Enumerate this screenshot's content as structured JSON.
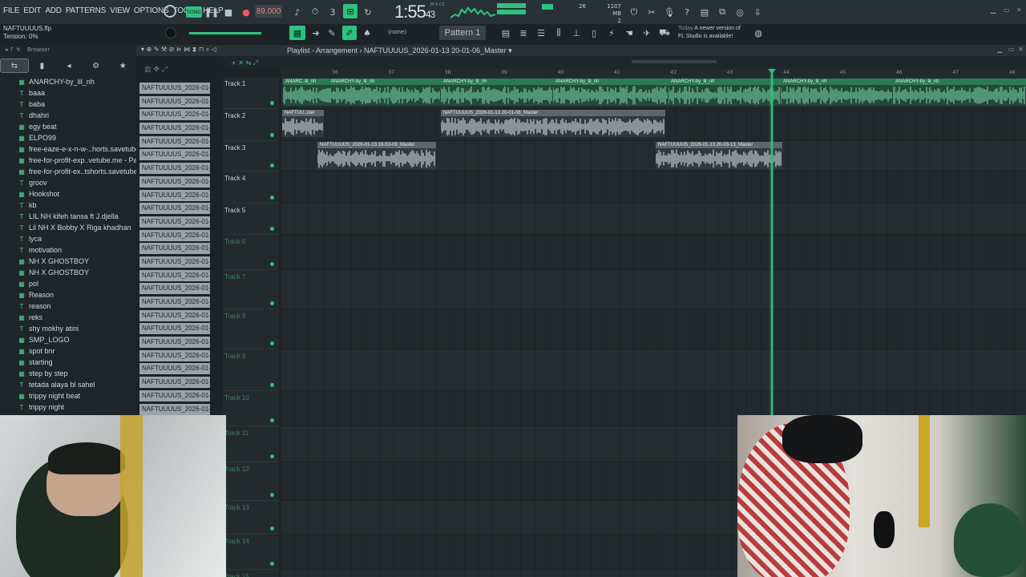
{
  "menu": [
    "FILE",
    "EDIT",
    "ADD",
    "PATTERNS",
    "VIEW",
    "OPTIONS",
    "TOOLS",
    "HELP"
  ],
  "song": {
    "file": "NAFTUUUUS.flp",
    "tension_label": "Tension:",
    "tension_value": "0%"
  },
  "transport": {
    "song_label": "SONG",
    "tempo": "89.000",
    "time_main": "1:55",
    "time_small": "43",
    "time_unit": "M:S:CS",
    "cpu": "26",
    "memory": "1107 MB",
    "polyphony": "2"
  },
  "toolbar": {
    "none_label": "(none)",
    "pattern": "Pattern 1"
  },
  "news": {
    "when": "Today",
    "line1": "A newer version of",
    "line2": "FL Studio is available!"
  },
  "browser": {
    "title": "Browser",
    "items": [
      {
        "name": "ANARCHY-by_lil_nh",
        "icon": "audio-file-icon"
      },
      {
        "name": "baaa",
        "icon": "sample-icon"
      },
      {
        "name": "baba",
        "icon": "sample-icon"
      },
      {
        "name": "dhahri",
        "icon": "sample-icon"
      },
      {
        "name": "egy beat",
        "icon": "audio-file-icon"
      },
      {
        "name": "ELPO99",
        "icon": "audio-file-icon"
      },
      {
        "name": "free-eaze-e-x-n-w-..horts.savetube.me",
        "icon": "audio-file-icon"
      },
      {
        "name": "free-for-profit-exp..vetube.me - Part_2",
        "icon": "audio-file-icon"
      },
      {
        "name": "free-for-profit-ex..tshorts.savetube.me",
        "icon": "audio-file-icon"
      },
      {
        "name": "groov",
        "icon": "sample-icon"
      },
      {
        "name": "Hookshot",
        "icon": "audio-file-icon"
      },
      {
        "name": "kb",
        "icon": "sample-icon"
      },
      {
        "name": "LIL NH kifeh tansa ft J.djella",
        "icon": "sample-icon"
      },
      {
        "name": "Lil NH X Bobby X Riga khadhan",
        "icon": "sample-icon"
      },
      {
        "name": "lyca",
        "icon": "sample-icon"
      },
      {
        "name": "motivation",
        "icon": "sample-icon"
      },
      {
        "name": "NH X GHOSTBOY",
        "icon": "audio-file-icon"
      },
      {
        "name": "NH X GHOSTBOY",
        "icon": "audio-file-icon"
      },
      {
        "name": "pol",
        "icon": "audio-file-icon"
      },
      {
        "name": "Reason",
        "icon": "audio-file-icon"
      },
      {
        "name": "reason",
        "icon": "sample-icon"
      },
      {
        "name": "reks",
        "icon": "audio-file-icon"
      },
      {
        "name": "shy mokhy atini",
        "icon": "sample-icon"
      },
      {
        "name": "SMP_LOGO",
        "icon": "audio-file-icon"
      },
      {
        "name": "spot bnr",
        "icon": "audio-file-icon"
      },
      {
        "name": "starting",
        "icon": "audio-file-icon"
      },
      {
        "name": "step by step",
        "icon": "audio-file-icon"
      },
      {
        "name": "tetada alaya bl sahel",
        "icon": "sample-icon"
      },
      {
        "name": "trippy night beat",
        "icon": "audio-file-icon"
      },
      {
        "name": "trippy night",
        "icon": "sample-icon"
      }
    ]
  },
  "picker": {
    "items": [
      "NAFTUUUUS_2026-01-13..",
      "NAFTUUUUS_2026-01-13..",
      "NAFTUUUUS_2026-01-13..",
      "NAFTUUUUS_2026-01-13..",
      "NAFTUUUUS_2026-01-13..",
      "NAFTUUUUS_2026-01-13..",
      "NAFTUUUUS_2026-01-13..",
      "NAFTUUUUS_2026-01-13..",
      "NAFTUUUUS_2026-01-13..",
      "NAFTUUUUS_2026-01-13..",
      "NAFTUUUUS_2026-01-13..",
      "NAFTUUUUS_2026-01-13..",
      "NAFTUUUUS_2026-01-13..",
      "NAFTUUUUS_2026-01-13..",
      "NAFTUUUUS_2026-01-13..",
      "NAFTUUUUS_2026-01-13..",
      "NAFTUUUUS_2026-01-13..",
      "NAFTUUUUS_2026-01-13..",
      "NAFTUUUUS_2026-01-13..",
      "NAFTUUUUS_2026-01-13..",
      "NAFTUUUUS_2026-01-13..",
      "NAFTUUUUS_2026-01-13..",
      "NAFTUUUUS_2026-01-13..",
      "NAFTUUUUS_2026-01-13..",
      "NAFTUUUUS_2026-01-13..",
      "NAFTUUUUS_2026-01-13.."
    ]
  },
  "playlist": {
    "title": "Playlist - Arrangement",
    "pattern_name": "NAFTUUUUS_2026-01-13 20-01-06_Master",
    "ruler": [
      "36",
      "37",
      "38",
      "39",
      "40",
      "41",
      "42",
      "43",
      "44",
      "45",
      "46",
      "47",
      "48"
    ],
    "tracks": [
      "Track 1",
      "Track 2",
      "Track 3",
      "Track 4",
      "Track 5",
      "Track 6",
      "Track 7",
      "Track 8",
      "Track 9",
      "Track 10",
      "Track 11",
      "Track 12",
      "Track 13",
      "Track 14",
      "Track 15"
    ],
    "clips": {
      "t1": [
        "ANARC..lil_nh",
        "ANARCHY-by_lil_nh",
        "ANARCHY-by_lil_nh",
        "ANARCHY-by_lil_nh",
        "ANARCHY-by_lil_nh",
        "ANARCHY-by_lil_nh",
        "ANARCHY-by_lil_nh"
      ],
      "t2": [
        "NAFTUU..ster",
        "NAFTUUUUS_2026-01-13 20-01-06_Master"
      ],
      "t3": [
        "NAFTUUUUS_2026-01-13 19-53-09_Master",
        "NAFTUUUUS_2026-01-13 20-03-13_Master"
      ]
    }
  },
  "colors": {
    "accent": "#2ec27e",
    "background": "#1c2226",
    "clip_green": "#24493b"
  }
}
